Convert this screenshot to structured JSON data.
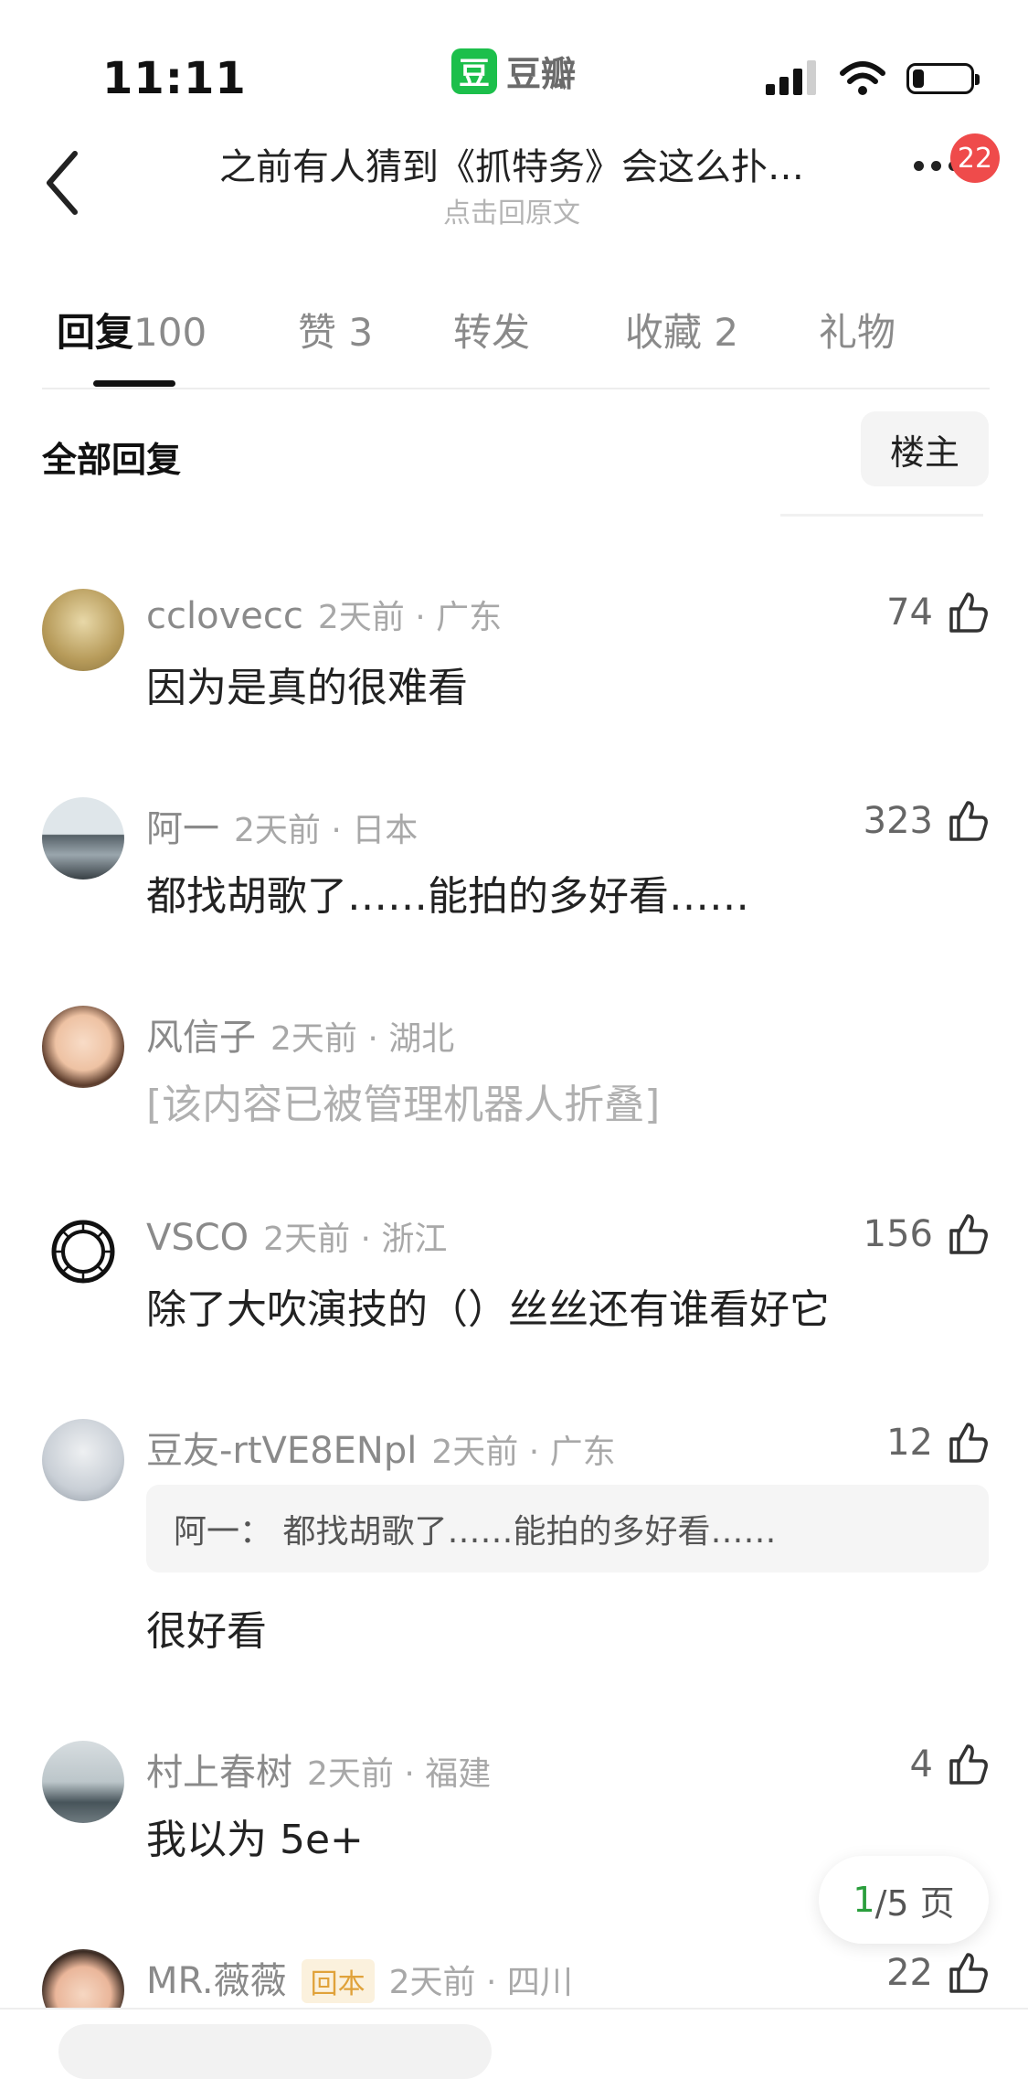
{
  "status_bar": {
    "time": "11:11",
    "app_logo_char": "豆",
    "app_name": "豆瓣",
    "battery_level": 0.2
  },
  "nav": {
    "title": "之前有人猜到《抓特务》会这么扑…",
    "subtitle": "点击回原文",
    "notification_count": "22"
  },
  "tabs": [
    {
      "label": "回复",
      "count": "100"
    },
    {
      "label": "赞",
      "count": "3"
    },
    {
      "label": "转发",
      "count": ""
    },
    {
      "label": "收藏",
      "count": "2"
    },
    {
      "label": "礼物",
      "count": ""
    }
  ],
  "section": {
    "title": "全部回复",
    "op_button": "楼主"
  },
  "comments": [
    {
      "user": "cclovecc",
      "time": "2天前 · 广东",
      "text": "因为是真的很难看",
      "likes": "74"
    },
    {
      "user": "阿一",
      "time": "2天前 · 日本",
      "text": "都找胡歌了……能拍的多好看……",
      "likes": "323"
    },
    {
      "user": "风信子",
      "time": "2天前 · 湖北",
      "text": "[该内容已被管理机器人折叠]",
      "likes": ""
    },
    {
      "user": "VSCO",
      "time": "2天前 · 浙江",
      "text": "除了大吹演技的（）丝丝还有谁看好它",
      "likes": "156"
    },
    {
      "user": "豆友-rtVE8ENpl",
      "time": "2天前 · 广东",
      "quote": "阿一： 都找胡歌了……能拍的多好看……",
      "text": "很好看",
      "likes": "12"
    },
    {
      "user": "村上春树",
      "time": "2天前 · 福建",
      "text": "我以为 5e+",
      "likes": "4"
    },
    {
      "user": "MR.薇薇",
      "tag": "回本",
      "time": "2天前 · 四川",
      "text": "",
      "likes": "22"
    }
  ],
  "pager": {
    "current": "1",
    "total_text": "/5 页"
  },
  "colors": {
    "accent_green": "#2a9e3c",
    "badge_red": "#ef4b4b",
    "logo_green": "#1cbf4b"
  },
  "icons": [
    "back-chevron-icon",
    "more-dots-icon",
    "thumbs-up-icon",
    "signal-icon",
    "wifi-icon",
    "battery-icon"
  ]
}
